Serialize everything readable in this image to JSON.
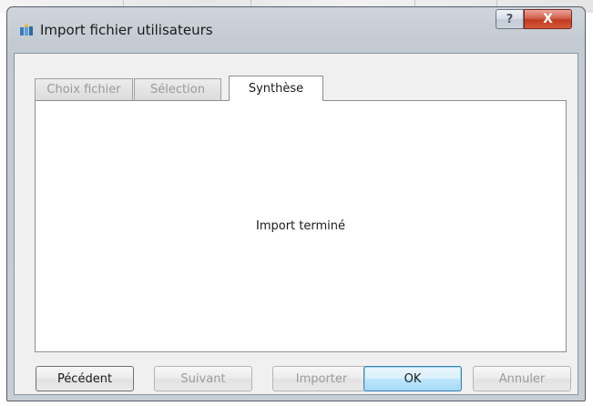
{
  "window": {
    "title": "Import fichier utilisateurs",
    "help_label": "?",
    "close_label": "X"
  },
  "tabs": [
    {
      "label": "Choix fichier",
      "active": false
    },
    {
      "label": "Sélection",
      "active": false
    },
    {
      "label": "Synthèse",
      "active": true
    }
  ],
  "panel": {
    "status": "Import terminé"
  },
  "buttons": {
    "previous": "Pécédent",
    "next": "Suivant",
    "import": "Importer",
    "ok": "OK",
    "cancel": "Annuler"
  },
  "icons": {
    "app": "app-icon",
    "help": "help-icon",
    "close": "close-icon"
  },
  "colors": {
    "close_button": "#c23a20",
    "default_button": "#bee6fd",
    "frame": "#c3cad2"
  }
}
